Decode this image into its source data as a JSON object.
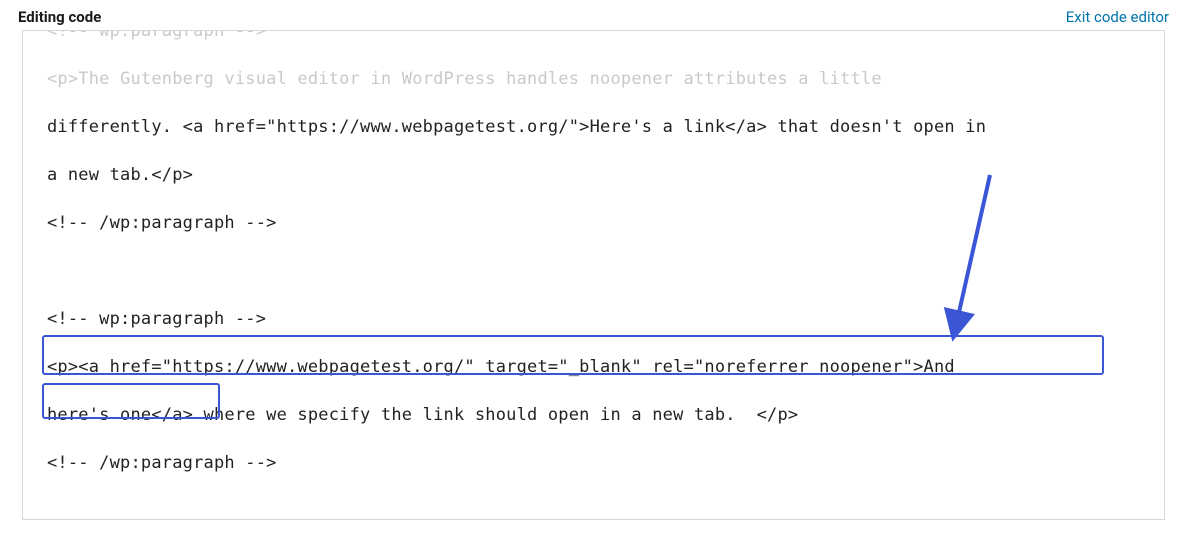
{
  "header": {
    "title": "Editing code",
    "exit_label": "Exit code editor"
  },
  "code": {
    "line1_faded": "<!-- wp:paragraph -->",
    "line2_faded": "<p>The Gutenberg visual editor in WordPress handles noopener attributes a little ",
    "line3": "differently. <a href=\"https://www.webpagetest.org/\">Here's a link</a> that doesn't open in ",
    "line4": "a new tab.</p>",
    "line5": "<!-- /wp:paragraph -->",
    "line6": "",
    "line7": "<!-- wp:paragraph -->",
    "line8": "<p><a href=\"https://www.webpagetest.org/\" target=\"_blank\" rel=\"noreferrer noopener\">And ",
    "line9": "here's one</a> where we specify the link should open in a new tab.  </p>",
    "line10": "<!-- /wp:paragraph -->"
  },
  "annotation": {
    "arrow_color": "#3a55d6",
    "highlight_color": "#3a55d6"
  }
}
